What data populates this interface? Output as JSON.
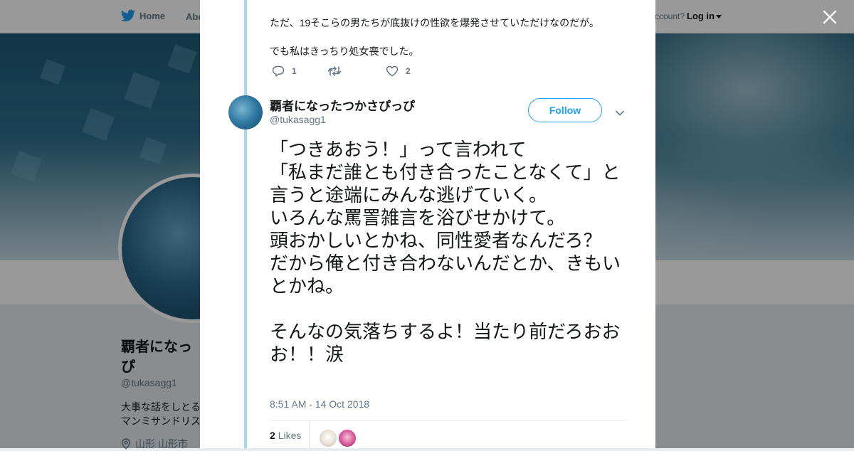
{
  "topnav": {
    "home_label": "Home",
    "about_label": "Abo",
    "account_prompt": "ccount?",
    "login_label": "Log in"
  },
  "profile": {
    "name": "覇者になっ",
    "name_line2": "ぴ",
    "handle": "@tukasagg1",
    "bio": "大事な話をしとる\nマンミサンドリス",
    "location": "山形 山形市"
  },
  "thread": {
    "previous_tweet": {
      "line1": "ただ、19そこらの男たちが底抜けの性欲を爆発させていただけなのだが。",
      "line2": "でも私はきっちり処女喪でした。",
      "reply_count": "1",
      "retweet_count": "",
      "like_count": "2"
    },
    "tweet": {
      "author_name": "覇者になったつかさぴっぴ",
      "author_handle": "@tukasagg1",
      "follow_label": "Follow",
      "paragraph1": "「つきあおう！」って言われて\n「私まだ誰とも付き合ったことなくて」と言うと途端にみんな逃げていく。\nいろんな罵詈雑言を浴びせかけて。\n頭おかしいとかね、同性愛者なんだろ？\nだから俺と付き合わないんだとか、きもいとかね。",
      "paragraph2": "そんなの気落ちするよ！当たり前だろおおお！！涙",
      "timestamp": "8:51 AM - 14 Oct 2018",
      "likes_count": "2",
      "likes_label": "Likes"
    }
  },
  "colors": {
    "brand": "#1da1f2",
    "thread_line": "#a6d7f6",
    "text": "#14171a",
    "muted": "#657786"
  },
  "icons": [
    "twitter-bird-icon",
    "close-icon",
    "reply-icon",
    "retweet-icon",
    "heart-icon",
    "chevron-down-icon",
    "location-pin-icon"
  ]
}
